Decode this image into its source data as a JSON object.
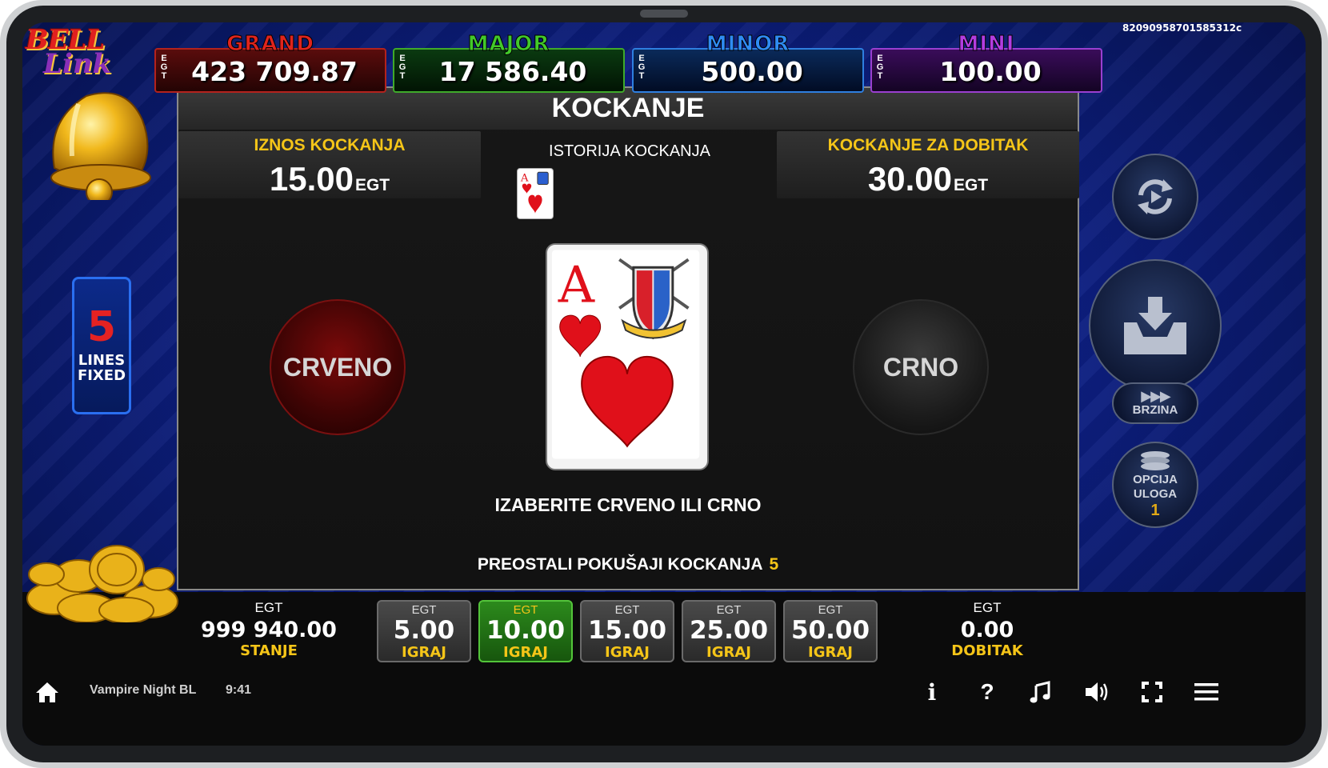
{
  "jackpots": [
    {
      "name": "GRAND",
      "currency": "EGT",
      "value": "423 709.87",
      "name_color": "#e0241c",
      "border": "#b3221d",
      "bg": "#3a0808"
    },
    {
      "name": "MAJOR",
      "currency": "EGT",
      "value": "17 586.40",
      "name_color": "#42c92a",
      "border": "#3faa2a",
      "bg": "#062a0a"
    },
    {
      "name": "MINOR",
      "currency": "EGT",
      "value": "500.00",
      "name_color": "#2f8cf3",
      "border": "#2e7fe0",
      "bg": "#041c3a"
    },
    {
      "name": "MINI",
      "currency": "EGT",
      "value": "100.00",
      "name_color": "#b33de0",
      "border": "#9a3fd0",
      "bg": "#24083a"
    }
  ],
  "serial": "82090958701585312c",
  "logo": {
    "line1": "BELL",
    "line2": "Link"
  },
  "panel": {
    "title": "KOCKANJE",
    "gamble_amount_label": "IZNOS KOCKANJA",
    "gamble_amount_value": "15.00",
    "gamble_amount_currency": "EGT",
    "history_label": "ISTORIJA KOCKANJA",
    "gamble_to_win_label": "KOCKANJE ZA DOBITAK",
    "gamble_to_win_value": "30.00",
    "gamble_to_win_currency": "EGT",
    "red_button": "CRVENO",
    "black_button": "CRNO",
    "card_rank": "A",
    "prompt": "IZABERITE CRVENO ILI CRNO",
    "remaining_label": "PREOSTALI POKUŠAJI KOCKANJA",
    "remaining_count": "5"
  },
  "lines": {
    "count": "5",
    "label_line1": "LINES",
    "label_line2": "FIXED"
  },
  "right_controls": {
    "speed_label": "BRZINA",
    "bet_option_label_line1": "OPCIJA",
    "bet_option_label_line2": "ULOGA",
    "bet_option_value": "1"
  },
  "balance": {
    "currency": "EGT",
    "value": "999 940.00",
    "label": "STANJE"
  },
  "win": {
    "currency": "EGT",
    "value": "0.00",
    "label": "DOBITAK"
  },
  "bets": [
    {
      "currency": "EGT",
      "value": "5.00",
      "label": "IGRAJ",
      "selected": false
    },
    {
      "currency": "EGT",
      "value": "10.00",
      "label": "IGRAJ",
      "selected": true
    },
    {
      "currency": "EGT",
      "value": "15.00",
      "label": "IGRAJ",
      "selected": false
    },
    {
      "currency": "EGT",
      "value": "25.00",
      "label": "IGRAJ",
      "selected": false
    },
    {
      "currency": "EGT",
      "value": "50.00",
      "label": "IGRAJ",
      "selected": false
    }
  ],
  "toolbar": {
    "game_name": "Vampire Night BL",
    "time": "9:41",
    "info_icon_glyph": "i",
    "help_icon_glyph": "?"
  },
  "colors": {
    "accent_yellow": "#f5c518",
    "selected_green": "#2c8a1c",
    "card_red": "#e0101a"
  }
}
